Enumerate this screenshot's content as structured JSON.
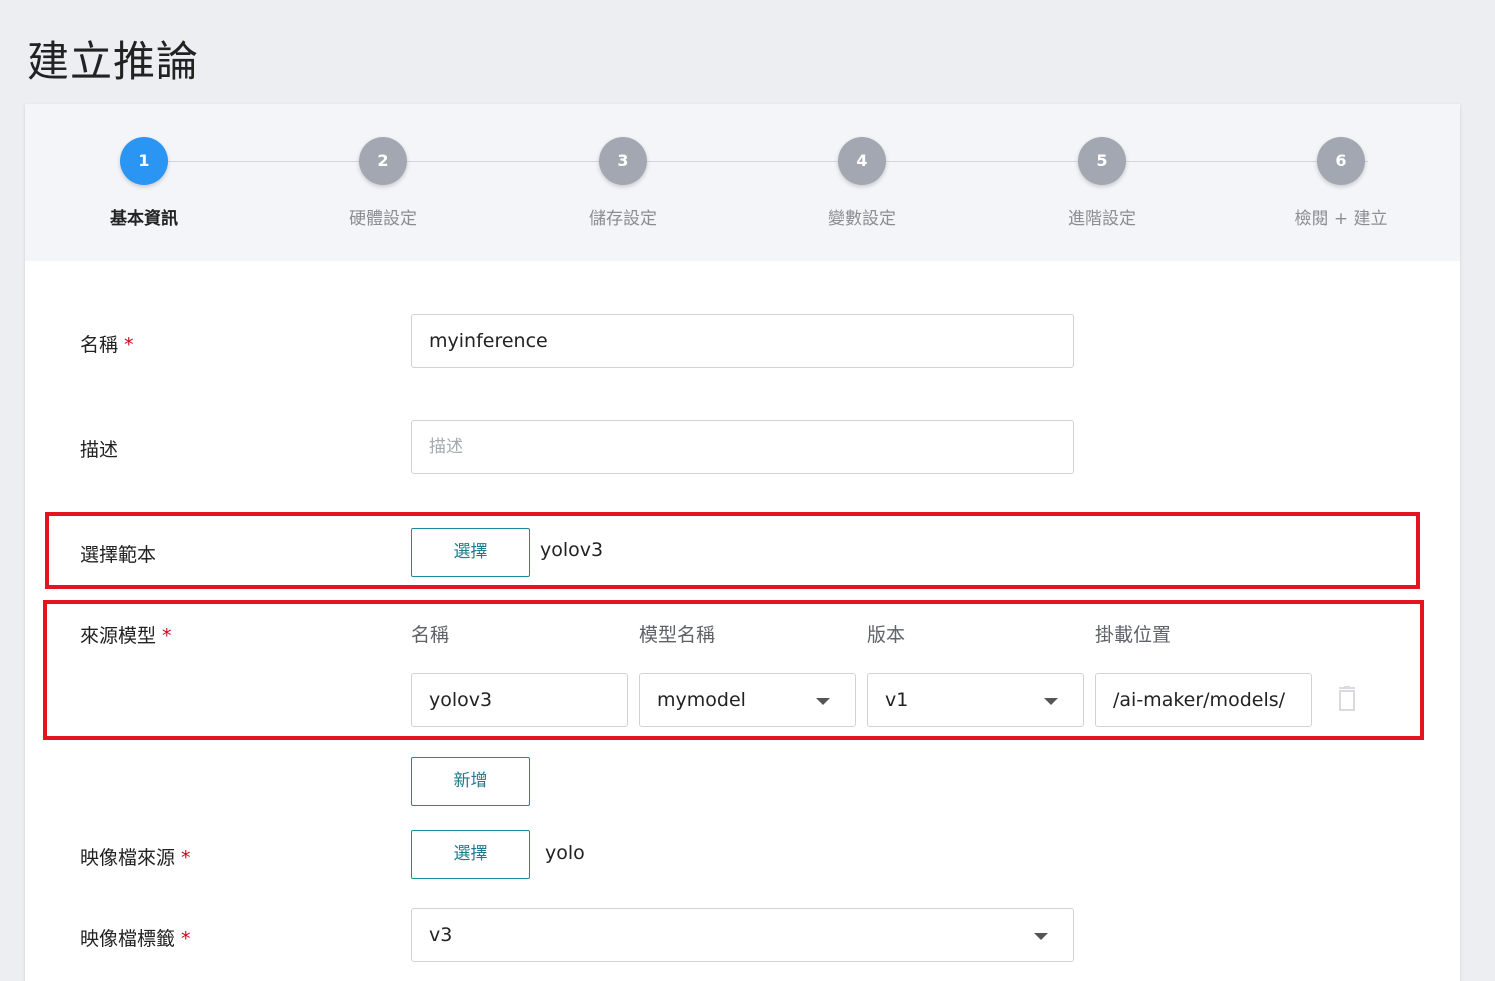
{
  "page": {
    "title": "建立推論"
  },
  "stepper": {
    "steps": [
      {
        "number": "1",
        "label": "基本資訊",
        "active": true
      },
      {
        "number": "2",
        "label": "硬體設定",
        "active": false
      },
      {
        "number": "3",
        "label": "儲存設定",
        "active": false
      },
      {
        "number": "4",
        "label": "變數設定",
        "active": false
      },
      {
        "number": "5",
        "label": "進階設定",
        "active": false
      },
      {
        "number": "6",
        "label": "檢閱 + 建立",
        "active": false
      }
    ]
  },
  "form": {
    "name": {
      "label": "名稱",
      "required": "*",
      "value": "myinference"
    },
    "description": {
      "label": "描述",
      "placeholder": "描述",
      "value": ""
    },
    "template": {
      "label": "選擇範本",
      "button": "選擇",
      "value": "yolov3"
    },
    "source_model": {
      "label": "來源模型",
      "required": "*",
      "columns": [
        "名稱",
        "模型名稱",
        "版本",
        "掛載位置"
      ],
      "row": {
        "name": "yolov3",
        "model_name": "mymodel",
        "version": "v1",
        "mount_path": "/ai-maker/models/"
      },
      "add_button": "新增"
    },
    "image_source": {
      "label": "映像檔來源",
      "required": "*",
      "button": "選擇",
      "value": "yolo"
    },
    "image_tag": {
      "label": "映像檔標籤",
      "required": "*",
      "value": "v3"
    }
  },
  "colors": {
    "accent": "#2b95f3",
    "highlight": "#e3141f",
    "button_border": "#1b8a9a"
  },
  "icons": {
    "delete": "trash-icon",
    "dropdown": "chevron-down-icon"
  }
}
